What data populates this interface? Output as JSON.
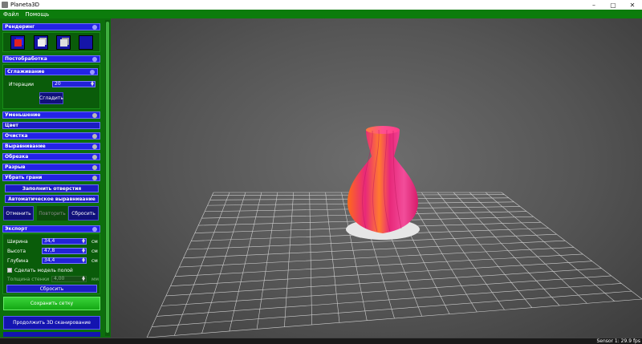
{
  "window": {
    "title": "Planeta3D",
    "min_icon": "minimize-icon",
    "max_icon": "maximize-icon",
    "close_icon": "close-icon"
  },
  "menu": {
    "items": [
      "Файл",
      "Помощь"
    ]
  },
  "render": {
    "title": "Рендеринг",
    "modes": [
      "color-cube-icon",
      "shaded-cube-icon",
      "wireframe-cube-icon",
      "hidden-mode-icon"
    ]
  },
  "postprocess": {
    "title": "Постобработка",
    "smoothing": {
      "title": "Сглаживание",
      "iterations_label": "Итерации",
      "iterations_value": "20",
      "smooth_button": "Сгладить"
    },
    "tools": [
      "Уменьшение",
      "Цвет",
      "Очистка",
      "Выравнивание",
      "Обрезка",
      "Разрыв",
      "Убрать грани"
    ],
    "fill_holes": "Заполнить отверстия",
    "auto_align": "Автоматическое выравнивание",
    "undo": "Отменить",
    "redo": "Повторить",
    "reset": "Сбросить"
  },
  "export": {
    "title": "Экспорт",
    "width_label": "Ширина",
    "width_value": "34,4",
    "height_label": "Высота",
    "height_value": "47,8",
    "depth_label": "Глубина",
    "depth_value": "34,4",
    "unit": "см",
    "hollow_label": "Сделать модель полой",
    "wall_label": "Толщина стенки",
    "wall_value": "4,00",
    "wall_unit": "мм",
    "reset": "Сбросить"
  },
  "save_mesh": "Сохранить сетку",
  "continue_scan": "Продолжить 3D сканирование",
  "status": {
    "sensor": "Sensor 1: 29.9 fps"
  },
  "colors": {
    "panel_green": "#0d6e0d",
    "accent_blue": "#2323e6",
    "vase_pink": "#e8287a",
    "vase_orange": "#ff6a1a"
  }
}
